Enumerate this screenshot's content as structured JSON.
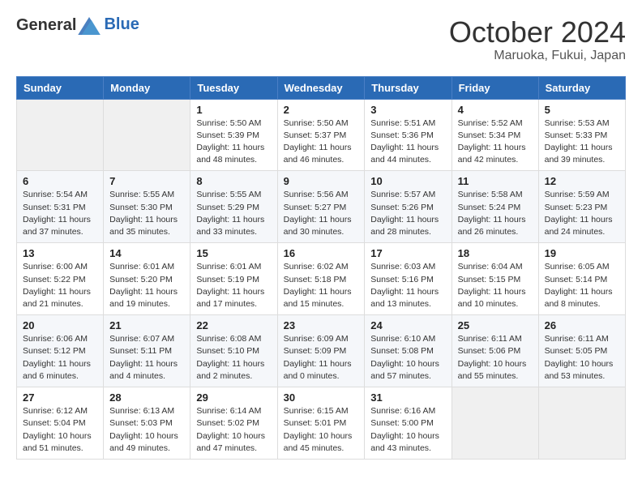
{
  "header": {
    "logo": {
      "general": "General",
      "blue": "Blue"
    },
    "title": "October 2024",
    "location": "Maruoka, Fukui, Japan"
  },
  "weekdays": [
    "Sunday",
    "Monday",
    "Tuesday",
    "Wednesday",
    "Thursday",
    "Friday",
    "Saturday"
  ],
  "weeks": [
    [
      {
        "day": "",
        "content": ""
      },
      {
        "day": "",
        "content": ""
      },
      {
        "day": "1",
        "content": "Sunrise: 5:50 AM\nSunset: 5:39 PM\nDaylight: 11 hours and 48 minutes."
      },
      {
        "day": "2",
        "content": "Sunrise: 5:50 AM\nSunset: 5:37 PM\nDaylight: 11 hours and 46 minutes."
      },
      {
        "day": "3",
        "content": "Sunrise: 5:51 AM\nSunset: 5:36 PM\nDaylight: 11 hours and 44 minutes."
      },
      {
        "day": "4",
        "content": "Sunrise: 5:52 AM\nSunset: 5:34 PM\nDaylight: 11 hours and 42 minutes."
      },
      {
        "day": "5",
        "content": "Sunrise: 5:53 AM\nSunset: 5:33 PM\nDaylight: 11 hours and 39 minutes."
      }
    ],
    [
      {
        "day": "6",
        "content": "Sunrise: 5:54 AM\nSunset: 5:31 PM\nDaylight: 11 hours and 37 minutes."
      },
      {
        "day": "7",
        "content": "Sunrise: 5:55 AM\nSunset: 5:30 PM\nDaylight: 11 hours and 35 minutes."
      },
      {
        "day": "8",
        "content": "Sunrise: 5:55 AM\nSunset: 5:29 PM\nDaylight: 11 hours and 33 minutes."
      },
      {
        "day": "9",
        "content": "Sunrise: 5:56 AM\nSunset: 5:27 PM\nDaylight: 11 hours and 30 minutes."
      },
      {
        "day": "10",
        "content": "Sunrise: 5:57 AM\nSunset: 5:26 PM\nDaylight: 11 hours and 28 minutes."
      },
      {
        "day": "11",
        "content": "Sunrise: 5:58 AM\nSunset: 5:24 PM\nDaylight: 11 hours and 26 minutes."
      },
      {
        "day": "12",
        "content": "Sunrise: 5:59 AM\nSunset: 5:23 PM\nDaylight: 11 hours and 24 minutes."
      }
    ],
    [
      {
        "day": "13",
        "content": "Sunrise: 6:00 AM\nSunset: 5:22 PM\nDaylight: 11 hours and 21 minutes."
      },
      {
        "day": "14",
        "content": "Sunrise: 6:01 AM\nSunset: 5:20 PM\nDaylight: 11 hours and 19 minutes."
      },
      {
        "day": "15",
        "content": "Sunrise: 6:01 AM\nSunset: 5:19 PM\nDaylight: 11 hours and 17 minutes."
      },
      {
        "day": "16",
        "content": "Sunrise: 6:02 AM\nSunset: 5:18 PM\nDaylight: 11 hours and 15 minutes."
      },
      {
        "day": "17",
        "content": "Sunrise: 6:03 AM\nSunset: 5:16 PM\nDaylight: 11 hours and 13 minutes."
      },
      {
        "day": "18",
        "content": "Sunrise: 6:04 AM\nSunset: 5:15 PM\nDaylight: 11 hours and 10 minutes."
      },
      {
        "day": "19",
        "content": "Sunrise: 6:05 AM\nSunset: 5:14 PM\nDaylight: 11 hours and 8 minutes."
      }
    ],
    [
      {
        "day": "20",
        "content": "Sunrise: 6:06 AM\nSunset: 5:12 PM\nDaylight: 11 hours and 6 minutes."
      },
      {
        "day": "21",
        "content": "Sunrise: 6:07 AM\nSunset: 5:11 PM\nDaylight: 11 hours and 4 minutes."
      },
      {
        "day": "22",
        "content": "Sunrise: 6:08 AM\nSunset: 5:10 PM\nDaylight: 11 hours and 2 minutes."
      },
      {
        "day": "23",
        "content": "Sunrise: 6:09 AM\nSunset: 5:09 PM\nDaylight: 11 hours and 0 minutes."
      },
      {
        "day": "24",
        "content": "Sunrise: 6:10 AM\nSunset: 5:08 PM\nDaylight: 10 hours and 57 minutes."
      },
      {
        "day": "25",
        "content": "Sunrise: 6:11 AM\nSunset: 5:06 PM\nDaylight: 10 hours and 55 minutes."
      },
      {
        "day": "26",
        "content": "Sunrise: 6:11 AM\nSunset: 5:05 PM\nDaylight: 10 hours and 53 minutes."
      }
    ],
    [
      {
        "day": "27",
        "content": "Sunrise: 6:12 AM\nSunset: 5:04 PM\nDaylight: 10 hours and 51 minutes."
      },
      {
        "day": "28",
        "content": "Sunrise: 6:13 AM\nSunset: 5:03 PM\nDaylight: 10 hours and 49 minutes."
      },
      {
        "day": "29",
        "content": "Sunrise: 6:14 AM\nSunset: 5:02 PM\nDaylight: 10 hours and 47 minutes."
      },
      {
        "day": "30",
        "content": "Sunrise: 6:15 AM\nSunset: 5:01 PM\nDaylight: 10 hours and 45 minutes."
      },
      {
        "day": "31",
        "content": "Sunrise: 6:16 AM\nSunset: 5:00 PM\nDaylight: 10 hours and 43 minutes."
      },
      {
        "day": "",
        "content": ""
      },
      {
        "day": "",
        "content": ""
      }
    ]
  ]
}
